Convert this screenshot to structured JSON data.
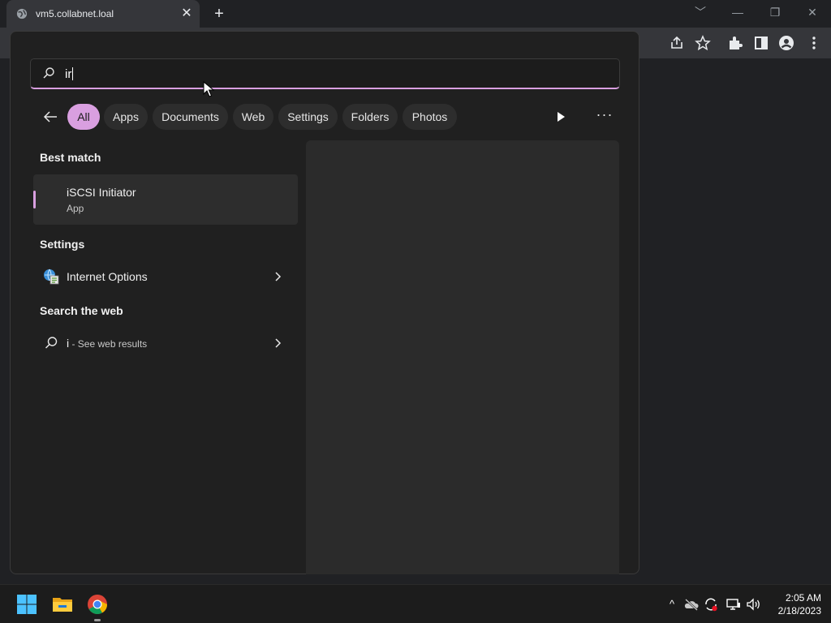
{
  "browser": {
    "tab_title": "vm5.collabnet.loal",
    "tab_close": "✕",
    "new_tab": "+",
    "window_controls": {
      "dropdown": "﹀",
      "minimize": "—",
      "restore": "❐",
      "close": "✕"
    },
    "toolbar_icons": [
      "share-icon",
      "star-icon",
      "extensions-icon",
      "side-panel-icon",
      "profile-icon",
      "menu-icon"
    ]
  },
  "search": {
    "query": "ir",
    "filters": [
      {
        "label": "All",
        "active": true
      },
      {
        "label": "Apps"
      },
      {
        "label": "Documents"
      },
      {
        "label": "Web"
      },
      {
        "label": "Settings"
      },
      {
        "label": "Folders"
      },
      {
        "label": "Photos"
      }
    ],
    "more": "···",
    "best_match": {
      "heading": "Best match",
      "name": "iSCSI Initiator",
      "type": "App"
    },
    "settings": {
      "heading": "Settings",
      "item": "Internet Options"
    },
    "web": {
      "heading": "Search the web",
      "term": "i",
      "suffix": " - See web results"
    }
  },
  "taskbar": {
    "apps": [
      "windows-start-icon",
      "file-explorer-icon",
      "chrome-icon"
    ],
    "tray": {
      "chevron": "^"
    },
    "time": "2:05 AM",
    "date": "2/18/2023"
  },
  "colors": {
    "accent": "#d99fe0",
    "panel": "#202020",
    "taskbar": "#1c1c1c"
  }
}
